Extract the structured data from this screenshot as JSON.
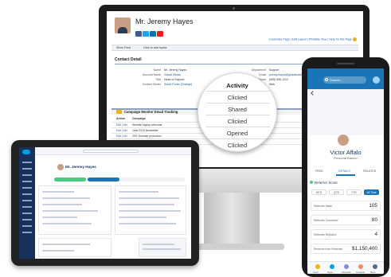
{
  "monitor": {
    "profile_name": "Mr. Jeremy Hayes",
    "header_links": "Customize Page | Edit Layout | Printable View | Help for this Page",
    "feed_bar": {
      "show_feed": "Show Feed",
      "click_to_add": "Click to add topics:"
    },
    "section_title": "Contact Detail",
    "details_left": [
      {
        "label": "Name",
        "value": "Mr. Jeremy Hayes",
        "link": false
      },
      {
        "label": "Account Name",
        "value": "Global Media",
        "link": true
      },
      {
        "label": "Title",
        "value": "Head of Support",
        "link": false
      },
      {
        "label": "Contact Owner",
        "value": "Sarah Porter [Change]",
        "link": true
      }
    ],
    "details_right": [
      {
        "label": "Department",
        "value": "Support",
        "link": false
      },
      {
        "label": "Email",
        "value": "jeremy.hayes@globalmedia.com",
        "link": true
      },
      {
        "label": "Phone",
        "value": "(905) 555-1212",
        "link": false
      },
      {
        "label": "Lead Source",
        "value": "Web",
        "link": false
      }
    ],
    "campaign": {
      "title": "Campaign Monitor Email Tracking",
      "headers": [
        "Action",
        "Campaign",
        "Sender Email"
      ],
      "rows": [
        {
          "action": "Edit | Del",
          "campaign": "Website signup welcome",
          "sender": "welcome@"
        },
        {
          "action": "Edit | Del",
          "campaign": "June 2015 Newsletter",
          "sender": "hello@"
        },
        {
          "action": "Edit | Del",
          "campaign": "20% Summer promotion",
          "sender": "hello@"
        },
        {
          "action": "Edit | Del",
          "campaign": "June 2015 Newsletter",
          "sender": "hello@"
        },
        {
          "action": "Edit | Del",
          "campaign": "Tips and tricks for new users",
          "sender": "welcome@"
        }
      ]
    }
  },
  "magnifier": {
    "header": "Activity",
    "rows": [
      "Clicked",
      "Shared",
      "Clicked",
      "Opened",
      "Clicked"
    ]
  },
  "tablet": {
    "record_title": "Mr. Jeremy Hayes"
  },
  "phone": {
    "search_placeholder": "Search...",
    "contact_name": "Victor Affalo",
    "contact_role": "Personal Banker",
    "tabs": [
      "FEED",
      "DETAILS",
      "RELATED"
    ],
    "section": "Referrer Score",
    "pills": [
      "MTD",
      "QTD",
      "YTD",
      "All Time"
    ],
    "metrics": [
      {
        "label": "Referrals Made",
        "value": "105"
      },
      {
        "label": "Referrals Converted",
        "value": "80"
      },
      {
        "label": "Referrals Rejected",
        "value": "4"
      },
      {
        "label": "Revenue from Referrals",
        "value": "$1,150,400"
      }
    ],
    "nav": [
      "Feed",
      "Opps",
      "Accounts",
      "Contacts",
      "More"
    ],
    "nav_colors": [
      "#f4b400",
      "#00a1e0",
      "#7f8de1",
      "#f88962",
      "#54698d"
    ]
  },
  "colors": {
    "brand_blue": "#1a74b8",
    "salesforce_nav": "#16325c",
    "link": "#1a5ea8"
  }
}
